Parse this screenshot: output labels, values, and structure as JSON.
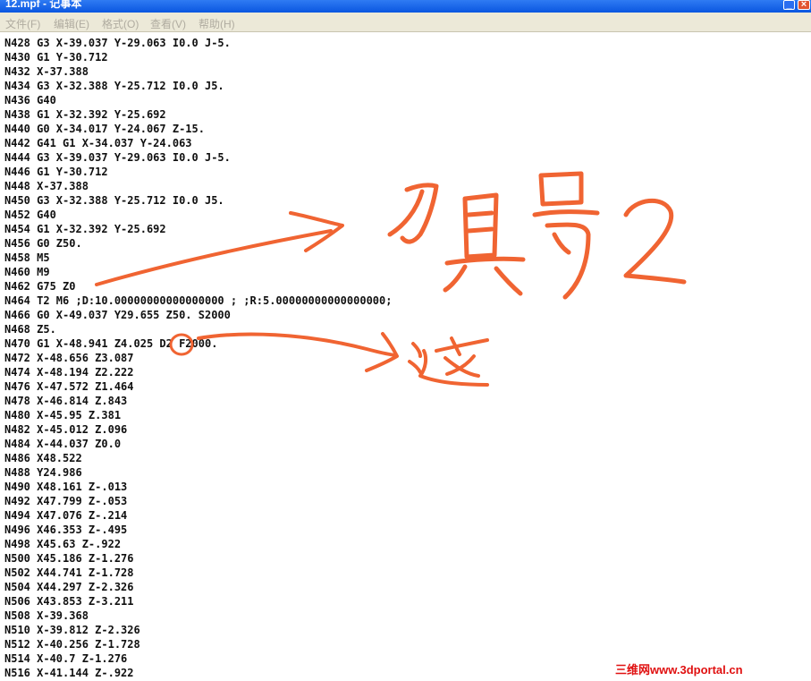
{
  "window": {
    "title": "12.mpf - 记事本",
    "minimize_label": "_",
    "close_label": "×"
  },
  "menu": [
    {
      "label": "文件(F)"
    },
    {
      "label": "编辑(E)"
    },
    {
      "label": "格式(O)"
    },
    {
      "label": "查看(V)"
    },
    {
      "label": "帮助(H)"
    }
  ],
  "lines": [
    "N428 G3 X-39.037 Y-29.063 I0.0 J-5.",
    "N430 G1 Y-30.712",
    "N432 X-37.388",
    "N434 G3 X-32.388 Y-25.712 I0.0 J5.",
    "N436 G40",
    "N438 G1 X-32.392 Y-25.692",
    "N440 G0 X-34.017 Y-24.067 Z-15.",
    "N442 G41 G1 X-34.037 Y-24.063",
    "N444 G3 X-39.037 Y-29.063 I0.0 J-5.",
    "N446 G1 Y-30.712",
    "N448 X-37.388",
    "N450 G3 X-32.388 Y-25.712 I0.0 J5.",
    "N452 G40",
    "N454 G1 X-32.392 Y-25.692",
    "N456 G0 Z50.",
    "N458 M5",
    "N460 M9",
    "N462 G75 Z0",
    "N464 T2 M6 ;D:10.00000000000000000 ; ;R:5.00000000000000000;",
    "N466 G0 X-49.037 Y29.655 Z50. S2000",
    "N468 Z5.",
    "N470 G1 X-48.941 Z4.025 D2 F2000.",
    "N472 X-48.656 Z3.087",
    "N474 X-48.194 Z2.222",
    "N476 X-47.572 Z1.464",
    "N478 X-46.814 Z.843",
    "N480 X-45.95 Z.381",
    "N482 X-45.012 Z.096",
    "N484 X-44.037 Z0.0",
    "N486 X48.522",
    "N488 Y24.986",
    "N490 X48.161 Z-.013",
    "N492 X47.799 Z-.053",
    "N494 X47.076 Z-.214",
    "N496 X46.353 Z-.495",
    "N498 X45.63 Z-.922",
    "N500 X45.186 Z-1.276",
    "N502 X44.741 Z-1.728",
    "N504 X44.297 Z-2.326",
    "N506 X43.853 Z-3.211",
    "N508 X-39.368",
    "N510 X-39.812 Z-2.326",
    "N512 X-40.256 Z-1.728",
    "N514 X-40.7 Z-1.276",
    "N516 X-41.144 Z-.922"
  ],
  "annotation": {
    "color": "#f06432",
    "handwritten_1": "刀具号2",
    "handwritten_2": "这"
  },
  "watermark": "三维网www.3dportal.cn"
}
